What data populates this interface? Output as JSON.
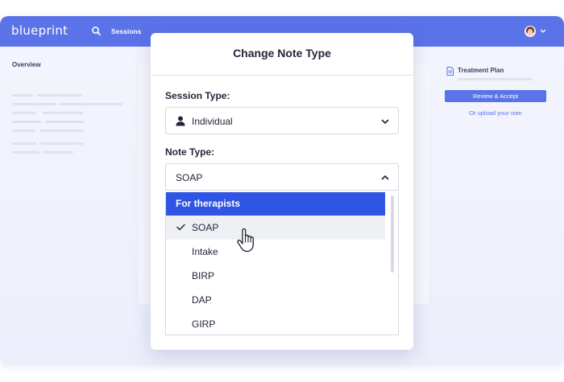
{
  "brand": {
    "logo": "blueprint",
    "primary_color": "#5b73e8",
    "accent_color": "#3054e3"
  },
  "nav": {
    "search_icon": "search-icon",
    "sessions_label": "Sessions",
    "avatar_icon": "user-avatar",
    "menu_icon": "chevron-down-icon"
  },
  "left_panel": {
    "title": "Overview"
  },
  "right_panel": {
    "plan_title": "Treatment Plan",
    "review_button": "Review & Accept",
    "upload_link": "Or upload your own"
  },
  "modal": {
    "title": "Change Note Type",
    "session_type": {
      "label": "Session Type:",
      "value": "Individual",
      "icon": "person-icon"
    },
    "note_type": {
      "label": "Note Type:",
      "value": "SOAP",
      "expanded": true
    },
    "dropdown": {
      "group_label": "For therapists",
      "options": [
        "SOAP",
        "Intake",
        "BIRP",
        "DAP",
        "GIRP"
      ],
      "selected": "SOAP"
    }
  }
}
